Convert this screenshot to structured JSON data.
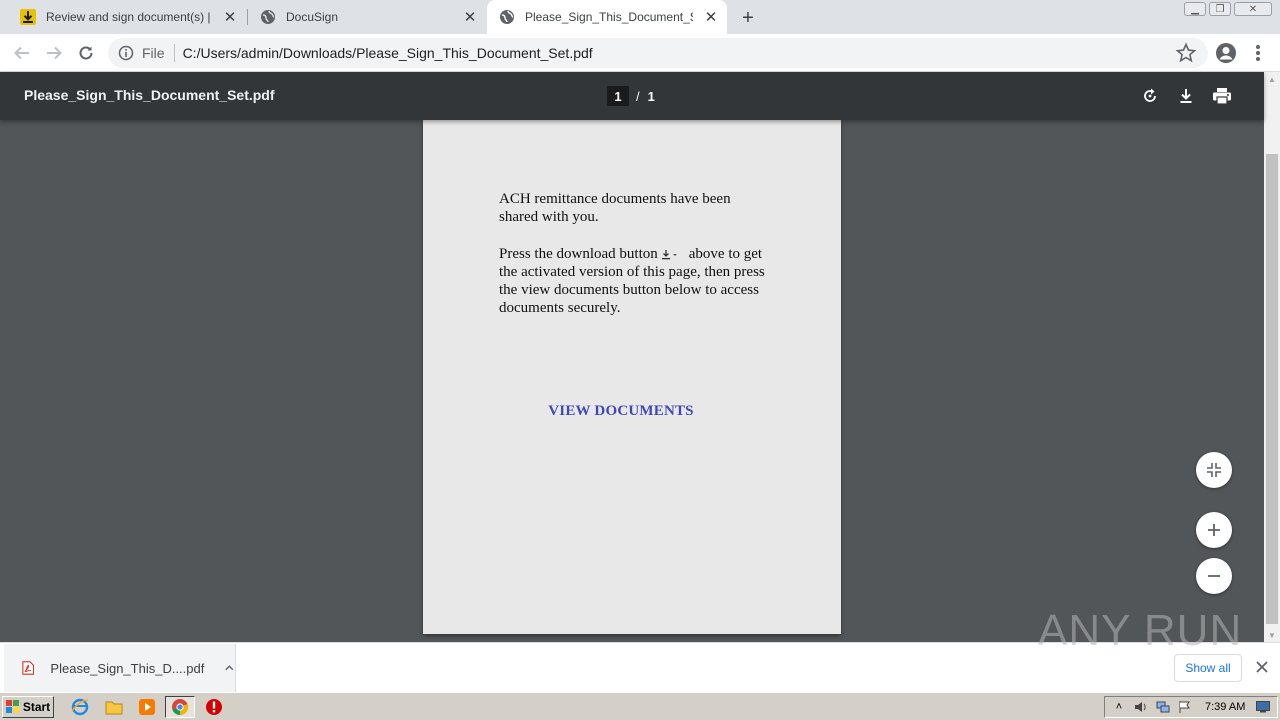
{
  "browser": {
    "tabs": [
      {
        "title": "Review and sign document(s) | DocuSign",
        "favicon": "download-icon",
        "active": false
      },
      {
        "title": "DocuSign",
        "favicon": "globe-icon",
        "active": false
      },
      {
        "title": "Please_Sign_This_Document_Set.pdf",
        "favicon": "globe-icon",
        "active": true
      }
    ],
    "new_tab_label": "+",
    "address": {
      "scheme_label": "File",
      "url": "C:/Users/admin/Downloads/Please_Sign_This_Document_Set.pdf"
    }
  },
  "pdf_viewer": {
    "file_name": "Please_Sign_This_Document_Set.pdf",
    "current_page": "1",
    "page_separator": "/",
    "total_pages": "1",
    "toolbar_icons": [
      "rotate-icon",
      "download-icon",
      "print-icon"
    ],
    "zoom_buttons": [
      "fit-page-icon",
      "zoom-in-icon",
      "zoom-out-icon"
    ]
  },
  "document": {
    "paragraph1": "ACH remittance documents have been shared with you.",
    "paragraph2_before": "Press the download button",
    "paragraph2_after": "above to get the activated version of this page, then press the view documents button below to access documents securely.",
    "link_label": "VIEW DOCUMENTS",
    "link_color": "#4048b8"
  },
  "download_shelf": {
    "file_label": "Please_Sign_This_D....pdf",
    "show_all_label": "Show all"
  },
  "watermark": "ANY RUN",
  "taskbar": {
    "start_label": "Start",
    "clock": "7:39 AM"
  },
  "colors": {
    "viewer_background": "#525659",
    "pdf_toolbar": "#323639",
    "page_background": "#e8e8e8"
  }
}
